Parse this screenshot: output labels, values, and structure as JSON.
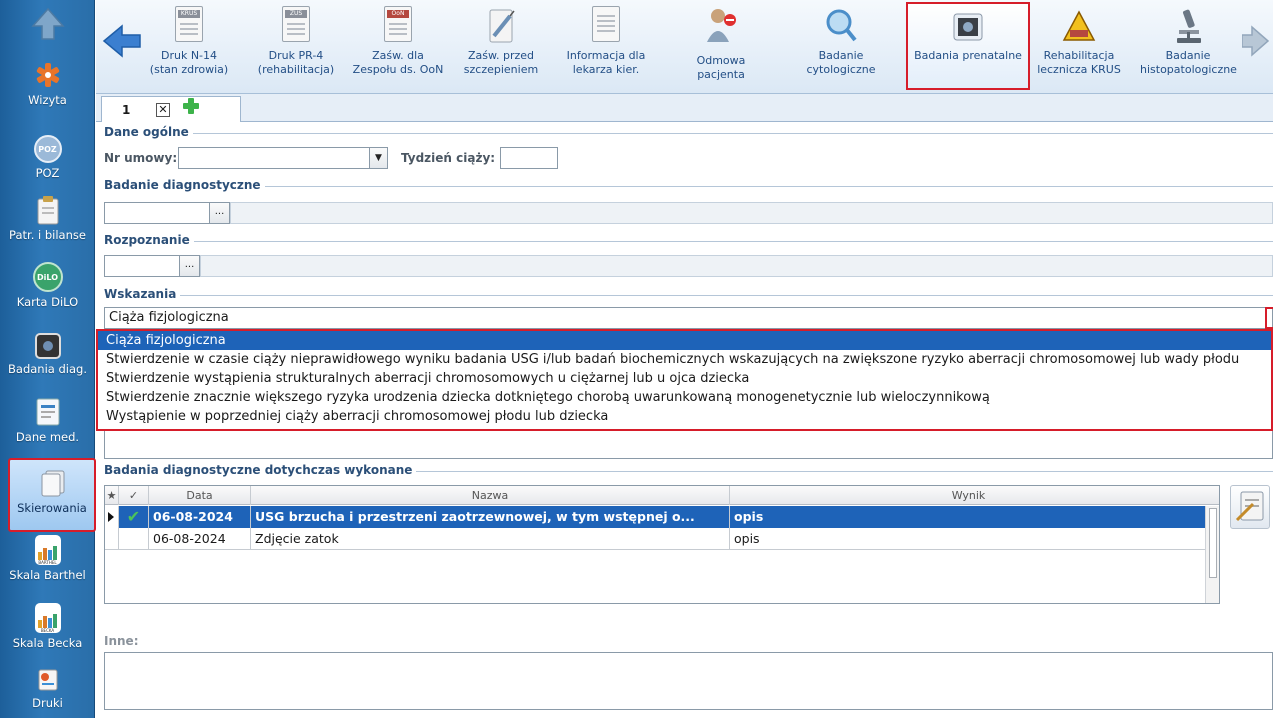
{
  "sidebar": {
    "items": [
      {
        "id": "wizyta",
        "label": "Wizyta"
      },
      {
        "id": "poz",
        "label": "POZ"
      },
      {
        "id": "patr",
        "label": "Patr. i bilanse"
      },
      {
        "id": "dilo",
        "label": "Karta DiLO"
      },
      {
        "id": "badania",
        "label": "Badania diag."
      },
      {
        "id": "dane",
        "label": "Dane med."
      },
      {
        "id": "skier",
        "label": "Skierowania"
      },
      {
        "id": "barthel",
        "label": "Skala Barthel"
      },
      {
        "id": "becka",
        "label": "Skala Becka"
      },
      {
        "id": "druki",
        "label": "Druki"
      }
    ],
    "icon_texts": {
      "poz": "POZ",
      "dilo": "DiLO",
      "barthel": "BARTHEL",
      "becka": "BECKA"
    }
  },
  "toolbar": {
    "buttons": [
      {
        "label": "Druk N-14 (stan zdrowia)",
        "tag": "KRUS"
      },
      {
        "label": "Druk PR-4 (rehabilitacja)",
        "tag": "ZUS"
      },
      {
        "label": "Zaśw. dla Zespołu ds. OoN",
        "tag": "OoN"
      },
      {
        "label": "Zaśw. przed szczepieniem"
      },
      {
        "label": "Informacja dla lekarza kier."
      },
      {
        "label": "Odmowa pacjenta"
      },
      {
        "label": "Badanie cytologiczne"
      },
      {
        "label": "Badania prenatalne"
      },
      {
        "label": "Rehabilitacja lecznicza KRUS",
        "tag": "KRUS"
      },
      {
        "label": "Badanie histopatologiczne"
      }
    ]
  },
  "tabs": {
    "active_label": "1"
  },
  "form": {
    "dane_ogolne": "Dane ogólne",
    "nr_umowy_label": "Nr umowy:",
    "nr_umowy_value": "",
    "tydzien_label": "Tydzień ciąży:",
    "tydzien_value": "",
    "badanie_diag_section": "Badanie diagnostyczne",
    "rozpoznanie_section": "Rozpoznanie",
    "wskazania_section": "Wskazania",
    "wskazania_value": "Ciąża fizjologiczna",
    "wskazania_options": [
      "Ciąża fizjologiczna",
      "Stwierdzenie w czasie ciąży nieprawidłowego wyniku badania USG i/lub badań biochemicznych wskazujących na zwiększone ryzyko aberracji chromosomowej lub wady płodu",
      "Stwierdzenie wystąpienia strukturalnych aberracji chromosomowych u ciężarnej lub u ojca dziecka",
      "Stwierdzenie znacznie większego ryzyka urodzenia dziecka dotkniętego chorobą uwarunkowaną monogenetycznie lub wieloczynnikową",
      "Wystąpienie w poprzedniej ciąży aberracji chromosomowej płodu lub dziecka"
    ],
    "ellipsis": "...",
    "prior_section": "Badania diagnostyczne dotychczas wykonane",
    "grid": {
      "columns": [
        "★",
        "✓",
        "Data",
        "Nazwa",
        "Wynik"
      ],
      "rows": [
        {
          "date": "06-08-2024",
          "name": "USG brzucha i przestrzeni zaotrzewnowej, w tym wstępnej o...",
          "result": "opis",
          "checked": true
        },
        {
          "date": "06-08-2024",
          "name": "Zdjęcie zatok",
          "result": "opis",
          "checked": false
        }
      ]
    },
    "inne_label": "Inne:"
  },
  "colors": {
    "sidebar_blue": "#2f79b8",
    "highlight_red": "#d61d2a",
    "selection_blue": "#1e63b8"
  }
}
